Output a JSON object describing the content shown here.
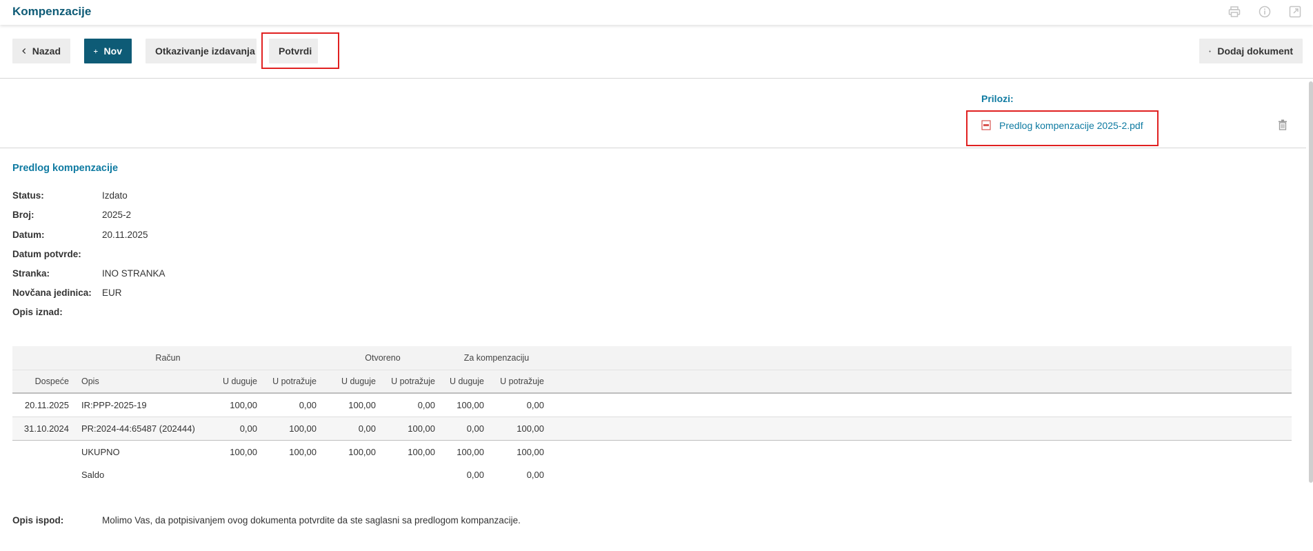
{
  "header": {
    "title": "Kompenzacije",
    "icons": [
      "print-icon",
      "info-icon",
      "external-link-icon"
    ]
  },
  "toolbar": {
    "back_label": "Nazad",
    "new_label": "Nov",
    "cancel_issue_label": "Otkazivanje izdavanja",
    "confirm_label": "Potvrdi",
    "add_document_label": "Dodaj dokument"
  },
  "attachments": {
    "title": "Prilozi:",
    "files": [
      {
        "name": "Predlog kompenzacije 2025-2.pdf",
        "icon": "pdf-file-icon"
      }
    ]
  },
  "proposal": {
    "title": "Predlog kompenzacije",
    "fields": [
      {
        "label": "Status:",
        "value": "Izdato"
      },
      {
        "label": "Broj:",
        "value": "2025-2"
      },
      {
        "label": "Datum:",
        "value": "20.11.2025"
      },
      {
        "label": "Datum potvrde:",
        "value": ""
      },
      {
        "label": "Stranka:",
        "value": "INO STRANKA"
      },
      {
        "label": "Novčana jedinica:",
        "value": "EUR"
      },
      {
        "label": "Opis iznad:",
        "value": ""
      }
    ]
  },
  "table": {
    "groups": {
      "racun": "Račun",
      "otvoreno": "Otvoreno",
      "za_kompenzaciju": "Za kompenzaciju"
    },
    "columns": [
      "Dospeće",
      "Opis",
      "U duguje",
      "U potražuje",
      "U duguje",
      "U potražuje",
      "U duguje",
      "U potražuje"
    ],
    "rows": [
      [
        "20.11.2025",
        "IR:PPP-2025-19",
        "100,00",
        "0,00",
        "100,00",
        "0,00",
        "100,00",
        "0,00"
      ],
      [
        "31.10.2024",
        "PR:2024-44:65487 (202444)",
        "0,00",
        "100,00",
        "0,00",
        "100,00",
        "0,00",
        "100,00"
      ]
    ],
    "total": [
      "UKUPNO",
      "100,00",
      "100,00",
      "100,00",
      "100,00",
      "100,00",
      "100,00"
    ],
    "saldo": [
      "Saldo",
      "0,00",
      "0,00"
    ]
  },
  "footer": {
    "label": "Opis ispod:",
    "text": "Molimo Vas, da potpisivanjem ovog dokumenta potvrdite da ste saglasni sa predlogom kompanzacije."
  },
  "colors": {
    "accent": "#0e5b76",
    "link": "#0e7aa1",
    "highlight": "#e02020"
  }
}
